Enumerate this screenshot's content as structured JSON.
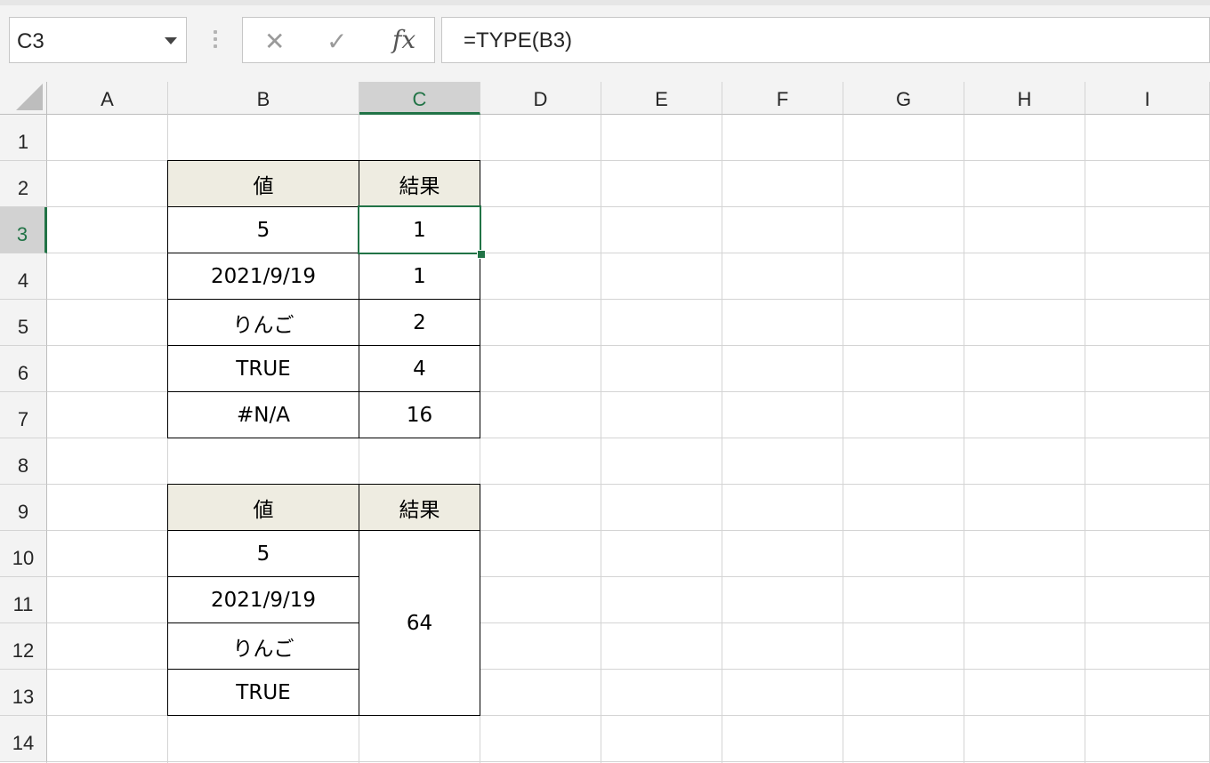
{
  "formula_bar": {
    "name_box": "C3",
    "cancel_icon": "✕",
    "enter_icon": "✓",
    "fx_label": "fx",
    "formula": "=TYPE(B3)"
  },
  "columns": [
    "A",
    "B",
    "C",
    "D",
    "E",
    "F",
    "G",
    "H",
    "I"
  ],
  "selected_column": "C",
  "rows": [
    "1",
    "2",
    "3",
    "4",
    "5",
    "6",
    "7",
    "8",
    "9",
    "10",
    "11",
    "12",
    "13",
    "14"
  ],
  "selected_row": "3",
  "table1": {
    "header_value": "値",
    "header_result": "結果",
    "rows": [
      {
        "value": "5",
        "result": "1"
      },
      {
        "value": "2021/9/19",
        "result": "1"
      },
      {
        "value": "りんご",
        "result": "2"
      },
      {
        "value": "TRUE",
        "result": "4"
      },
      {
        "value": "#N/A",
        "result": "16"
      }
    ]
  },
  "table2": {
    "header_value": "値",
    "header_result": "結果",
    "values": [
      "5",
      "2021/9/19",
      "りんご",
      "TRUE"
    ],
    "merged_result": "64"
  },
  "colors": {
    "accent": "#217346",
    "header_fill": "#eeece1",
    "grid": "#d4d4d4"
  }
}
